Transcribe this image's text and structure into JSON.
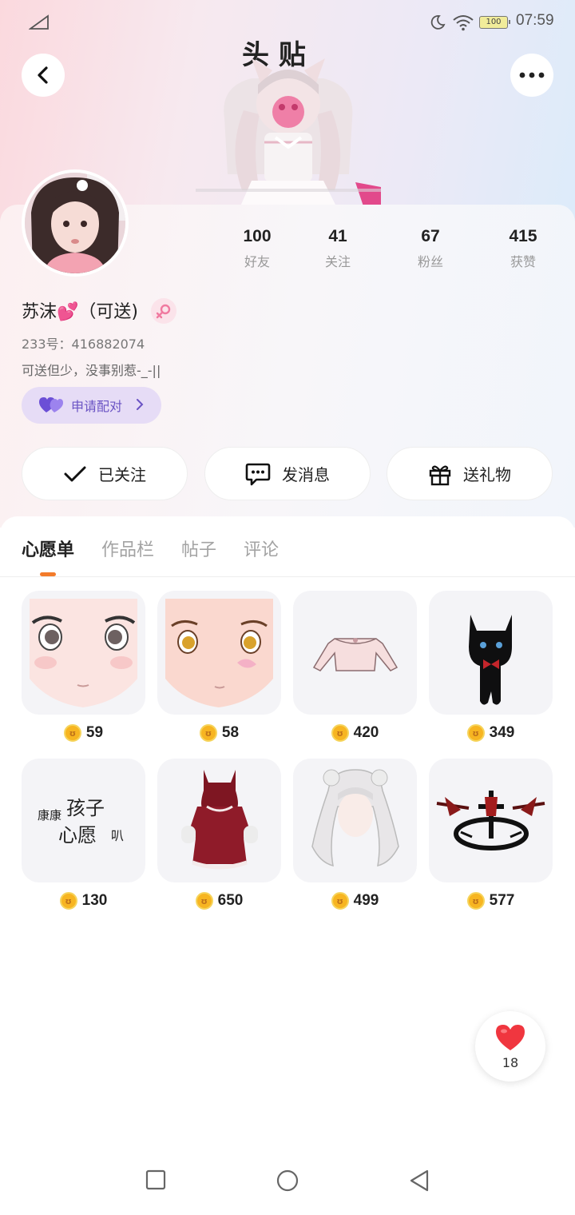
{
  "status_bar": {
    "time": "07:59",
    "battery": "100"
  },
  "banner": {
    "text": "头 贴"
  },
  "profile": {
    "stats": [
      {
        "value": "100",
        "label": "好友"
      },
      {
        "value": "41",
        "label": "关注"
      },
      {
        "value": "67",
        "label": "粉丝"
      },
      {
        "value": "415",
        "label": "获赞"
      }
    ],
    "nickname": "苏沫💕（可送)",
    "uid": "233号：416882074",
    "bio": "可送但少，没事别惹-_-||",
    "pair_label": "申请配对"
  },
  "actions": {
    "follow_label": "已关注",
    "message_label": "发消息",
    "gift_label": "送礼物"
  },
  "tabs": [
    {
      "label": "心愿单",
      "active": true
    },
    {
      "label": "作品栏",
      "active": false
    },
    {
      "label": "帖子",
      "active": false
    },
    {
      "label": "评论",
      "active": false
    }
  ],
  "wishlist": [
    {
      "name": "anime-face-brown-eyes",
      "price": "59"
    },
    {
      "name": "anime-face-amber-eyes",
      "price": "58"
    },
    {
      "name": "pink-sweater",
      "price": "420"
    },
    {
      "name": "black-cat-accessory",
      "price": "349"
    },
    {
      "name": "text-sticker",
      "price": "130",
      "sticker_text_1": "康康",
      "sticker_text_2": "孩子",
      "sticker_text_3": "心愿",
      "sticker_text_4": "叭"
    },
    {
      "name": "red-hood-dress",
      "price": "650"
    },
    {
      "name": "white-long-hair",
      "price": "499"
    },
    {
      "name": "red-halo-ornament",
      "price": "577"
    }
  ],
  "coin_glyph": "ʊ",
  "like_fab": {
    "count": "18"
  },
  "colors": {
    "accent_orange": "#f37b2a",
    "pair_purple": "#6a53c4",
    "coin_gold": "#f7b521",
    "heart_red": "#f0363f"
  }
}
